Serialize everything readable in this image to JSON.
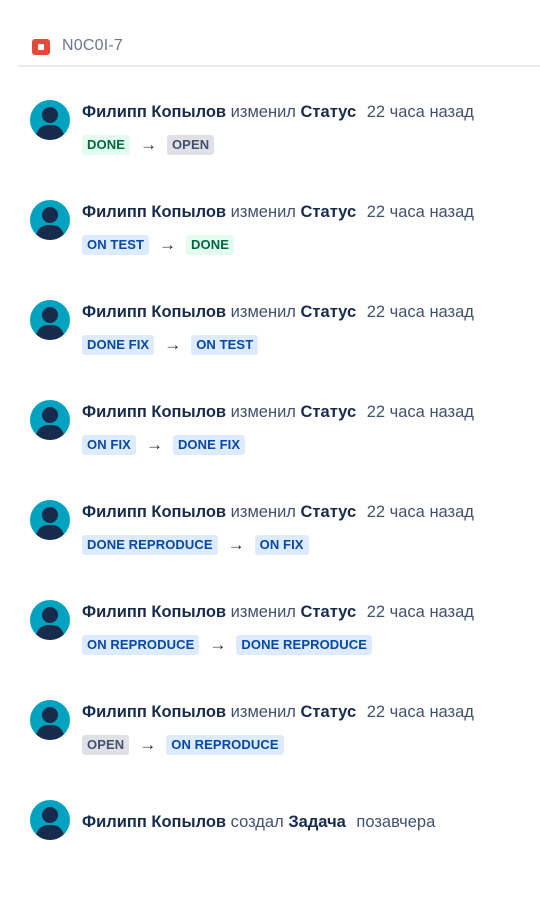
{
  "issue": {
    "key": "N0C0I-7"
  },
  "changes": [
    {
      "author": "Филипп Копылов",
      "verb": "изменил",
      "field": "Статус",
      "time": "22 часа назад",
      "from": {
        "label": "DONE",
        "color": "green"
      },
      "arrow": "→",
      "to": {
        "label": "OPEN",
        "color": "grey"
      }
    },
    {
      "author": "Филипп Копылов",
      "verb": "изменил",
      "field": "Статус",
      "time": "22 часа назад",
      "from": {
        "label": "ON TEST",
        "color": "blue"
      },
      "arrow": "→",
      "to": {
        "label": "DONE",
        "color": "green"
      }
    },
    {
      "author": "Филипп Копылов",
      "verb": "изменил",
      "field": "Статус",
      "time": "22 часа назад",
      "from": {
        "label": "DONE FIX",
        "color": "blue"
      },
      "arrow": "→",
      "to": {
        "label": "ON TEST",
        "color": "blue"
      }
    },
    {
      "author": "Филипп Копылов",
      "verb": "изменил",
      "field": "Статус",
      "time": "22 часа назад",
      "from": {
        "label": "ON FIX",
        "color": "blue"
      },
      "arrow": "→",
      "to": {
        "label": "DONE FIX",
        "color": "blue"
      }
    },
    {
      "author": "Филипп Копылов",
      "verb": "изменил",
      "field": "Статус",
      "time": "22 часа назад",
      "from": {
        "label": "DONE REPRODUCE",
        "color": "blue"
      },
      "arrow": "→",
      "to": {
        "label": "ON FIX",
        "color": "blue"
      }
    },
    {
      "author": "Филипп Копылов",
      "verb": "изменил",
      "field": "Статус",
      "time": "22 часа назад",
      "from": {
        "label": "ON REPRODUCE",
        "color": "blue"
      },
      "arrow": "→",
      "to": {
        "label": "DONE REPRODUCE",
        "color": "blue"
      }
    },
    {
      "author": "Филипп Копылов",
      "verb": "изменил",
      "field": "Статус",
      "time": "22 часа назад",
      "from": {
        "label": "OPEN",
        "color": "grey"
      },
      "arrow": "→",
      "to": {
        "label": "ON REPRODUCE",
        "color": "blue"
      }
    }
  ],
  "created": {
    "author": "Филипп Копылов",
    "verb": "создал",
    "field": "Задача",
    "time": "позавчера"
  },
  "colors": {
    "green_bg": "#e3fcef",
    "green_fg": "#006644",
    "grey_bg": "#dfe1e6",
    "grey_fg": "#42526e",
    "blue_bg": "#deebff",
    "blue_fg": "#0747a6",
    "avatar": "#00a3bf",
    "issue_icon": "#e5493a"
  }
}
